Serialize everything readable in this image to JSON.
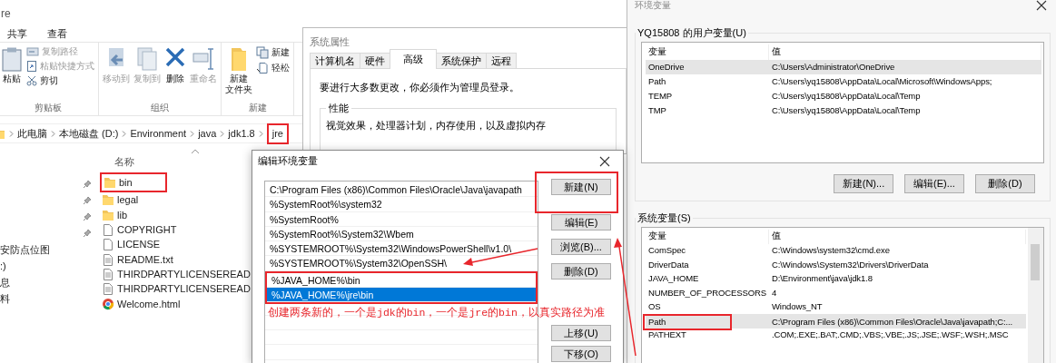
{
  "explorer": {
    "title": "re",
    "ribbon_tabs": [
      "共享",
      "查看"
    ],
    "ribbon_groups": [
      {
        "label": "剪贴板",
        "items": [
          {
            "kind": "paste",
            "label": "粘贴",
            "disabled": false
          },
          {
            "kind": "copy-path",
            "label": "复制路径",
            "disabled": true
          },
          {
            "kind": "paste-shortcut",
            "label": "粘贴快捷方式",
            "disabled": true
          },
          {
            "kind": "cut",
            "label": "剪切",
            "disabled": false
          }
        ]
      },
      {
        "label": "组织",
        "items": [
          {
            "kind": "move-to",
            "label": "移动到",
            "disabled": true
          },
          {
            "kind": "copy-to",
            "label": "复制到",
            "disabled": true
          },
          {
            "kind": "delete",
            "label": "删除",
            "disabled": false
          },
          {
            "kind": "rename",
            "label": "重命名",
            "disabled": true
          }
        ]
      },
      {
        "label": "新建",
        "items": [
          {
            "kind": "new-folder",
            "label_lines": [
              "新建",
              "文件夹"
            ],
            "disabled": false
          },
          {
            "kind": "new-item",
            "label": "新建",
            "disabled": false
          },
          {
            "kind": "easy-access",
            "label": "轻松",
            "disabled": false
          }
        ]
      }
    ],
    "breadcrumb": [
      {
        "label": "此电脑",
        "annotated": false
      },
      {
        "label": "本地磁盘 (D:)",
        "annotated": false
      },
      {
        "label": "Environment",
        "annotated": false
      },
      {
        "label": "java",
        "annotated": false
      },
      {
        "label": "jdk1.8",
        "annotated": false
      },
      {
        "label": "jre",
        "annotated": true
      }
    ],
    "nav_items": [
      "安防点位图",
      ":)",
      "息",
      "料"
    ],
    "column_header": "名称",
    "files": [
      {
        "kind": "folder",
        "name": "bin",
        "annotated": true
      },
      {
        "kind": "folder",
        "name": "legal",
        "annotated": false
      },
      {
        "kind": "folder",
        "name": "lib",
        "annotated": false
      },
      {
        "kind": "file",
        "name": "COPYRIGHT",
        "annotated": false
      },
      {
        "kind": "file",
        "name": "LICENSE",
        "annotated": false
      },
      {
        "kind": "text",
        "name": "README.txt",
        "annotated": false
      },
      {
        "kind": "text",
        "name": "THIRDPARTYLICENSEREAD",
        "annotated": false
      },
      {
        "kind": "text",
        "name": "THIRDPARTYLICENSEREAD",
        "annotated": false
      },
      {
        "kind": "web",
        "name": "Welcome.html",
        "annotated": false
      }
    ]
  },
  "system_properties": {
    "title": "系统属性",
    "tabs": [
      {
        "label": "计算机名",
        "selected": false
      },
      {
        "label": "硬件",
        "selected": false
      },
      {
        "label": "高级",
        "selected": true
      },
      {
        "label": "系统保护",
        "selected": false
      },
      {
        "label": "远程",
        "selected": false
      }
    ],
    "notice": "要进行大多数更改，你必须作为管理员登录。",
    "group_label": "性能",
    "group_text": "视觉效果，处理器计划，内存使用，以及虚拟内存"
  },
  "environment_variables": {
    "title": "环境变量",
    "user_group": "YQ15808 的用户变量(U)",
    "columns": [
      "变量",
      "值"
    ],
    "user_rows": [
      {
        "name": "OneDrive",
        "value": "C:\\Users\\Administrator\\OneDrive",
        "selected": true,
        "annotated": false
      },
      {
        "name": "Path",
        "value": "C:\\Users\\yq15808\\AppData\\Local\\Microsoft\\WindowsApps;",
        "selected": false,
        "annotated": false
      },
      {
        "name": "TEMP",
        "value": "C:\\Users\\yq15808\\AppData\\Local\\Temp",
        "selected": false,
        "annotated": false
      },
      {
        "name": "TMP",
        "value": "C:\\Users\\yq15808\\AppData\\Local\\Temp",
        "selected": false,
        "annotated": false
      }
    ],
    "user_buttons": [
      "新建(N)...",
      "编辑(E)...",
      "删除(D)"
    ],
    "system_group": "系统变量(S)",
    "system_columns": [
      "变量",
      "值"
    ],
    "system_rows": [
      {
        "name": "ComSpec",
        "value": "C:\\Windows\\system32\\cmd.exe",
        "selected": false,
        "annotated": false
      },
      {
        "name": "DriverData",
        "value": "C:\\Windows\\System32\\Drivers\\DriverData",
        "selected": false,
        "annotated": false
      },
      {
        "name": "JAVA_HOME",
        "value": "D:\\Environment\\java\\jdk1.8",
        "selected": false,
        "annotated": false
      },
      {
        "name": "NUMBER_OF_PROCESSORS",
        "value": "4",
        "selected": false,
        "annotated": false
      },
      {
        "name": "OS",
        "value": "Windows_NT",
        "selected": false,
        "annotated": false
      },
      {
        "name": "Path",
        "value": "C:\\Program Files (x86)\\Common Files\\Oracle\\Java\\javapath;C:...",
        "selected": true,
        "annotated": true
      },
      {
        "name": "PATHEXT",
        "value": ".COM;.EXE;.BAT;.CMD;.VBS;.VBE;.JS;.JSE;.WSF;.WSH;.MSC",
        "selected": false,
        "annotated": false
      }
    ]
  },
  "edit_dialog": {
    "title": "编辑环境变量",
    "entries": [
      {
        "text": "C:\\Program Files (x86)\\Common Files\\Oracle\\Java\\javapath",
        "selected": false,
        "annotated": false
      },
      {
        "text": "%SystemRoot%\\system32",
        "selected": false,
        "annotated": false
      },
      {
        "text": "%SystemRoot%",
        "selected": false,
        "annotated": false
      },
      {
        "text": "%SystemRoot%\\System32\\Wbem",
        "selected": false,
        "annotated": false
      },
      {
        "text": "%SYSTEMROOT%\\System32\\WindowsPowerShell\\v1.0\\",
        "selected": false,
        "annotated": false
      },
      {
        "text": "%SYSTEMROOT%\\System32\\OpenSSH\\",
        "selected": false,
        "annotated": false
      },
      {
        "text": "%JAVA_HOME%\\bin",
        "selected": false,
        "annotated": true
      },
      {
        "text": "%JAVA_HOME%\\jre\\bin",
        "selected": true,
        "annotated": true
      }
    ],
    "buttons": [
      {
        "label": "新建(N)",
        "annotated": true
      },
      {
        "label": "编辑(E)",
        "annotated": false
      },
      {
        "label": "浏览(B)...",
        "annotated": false
      },
      {
        "label": "删除(D)",
        "annotated": false
      },
      {
        "label": "上移(U)",
        "annotated": false
      },
      {
        "label": "下移(O)",
        "annotated": false
      }
    ]
  },
  "annotation_note": "创建两条新的，一个是jdk的bin，一个是jre的bin，以真实路径为准"
}
